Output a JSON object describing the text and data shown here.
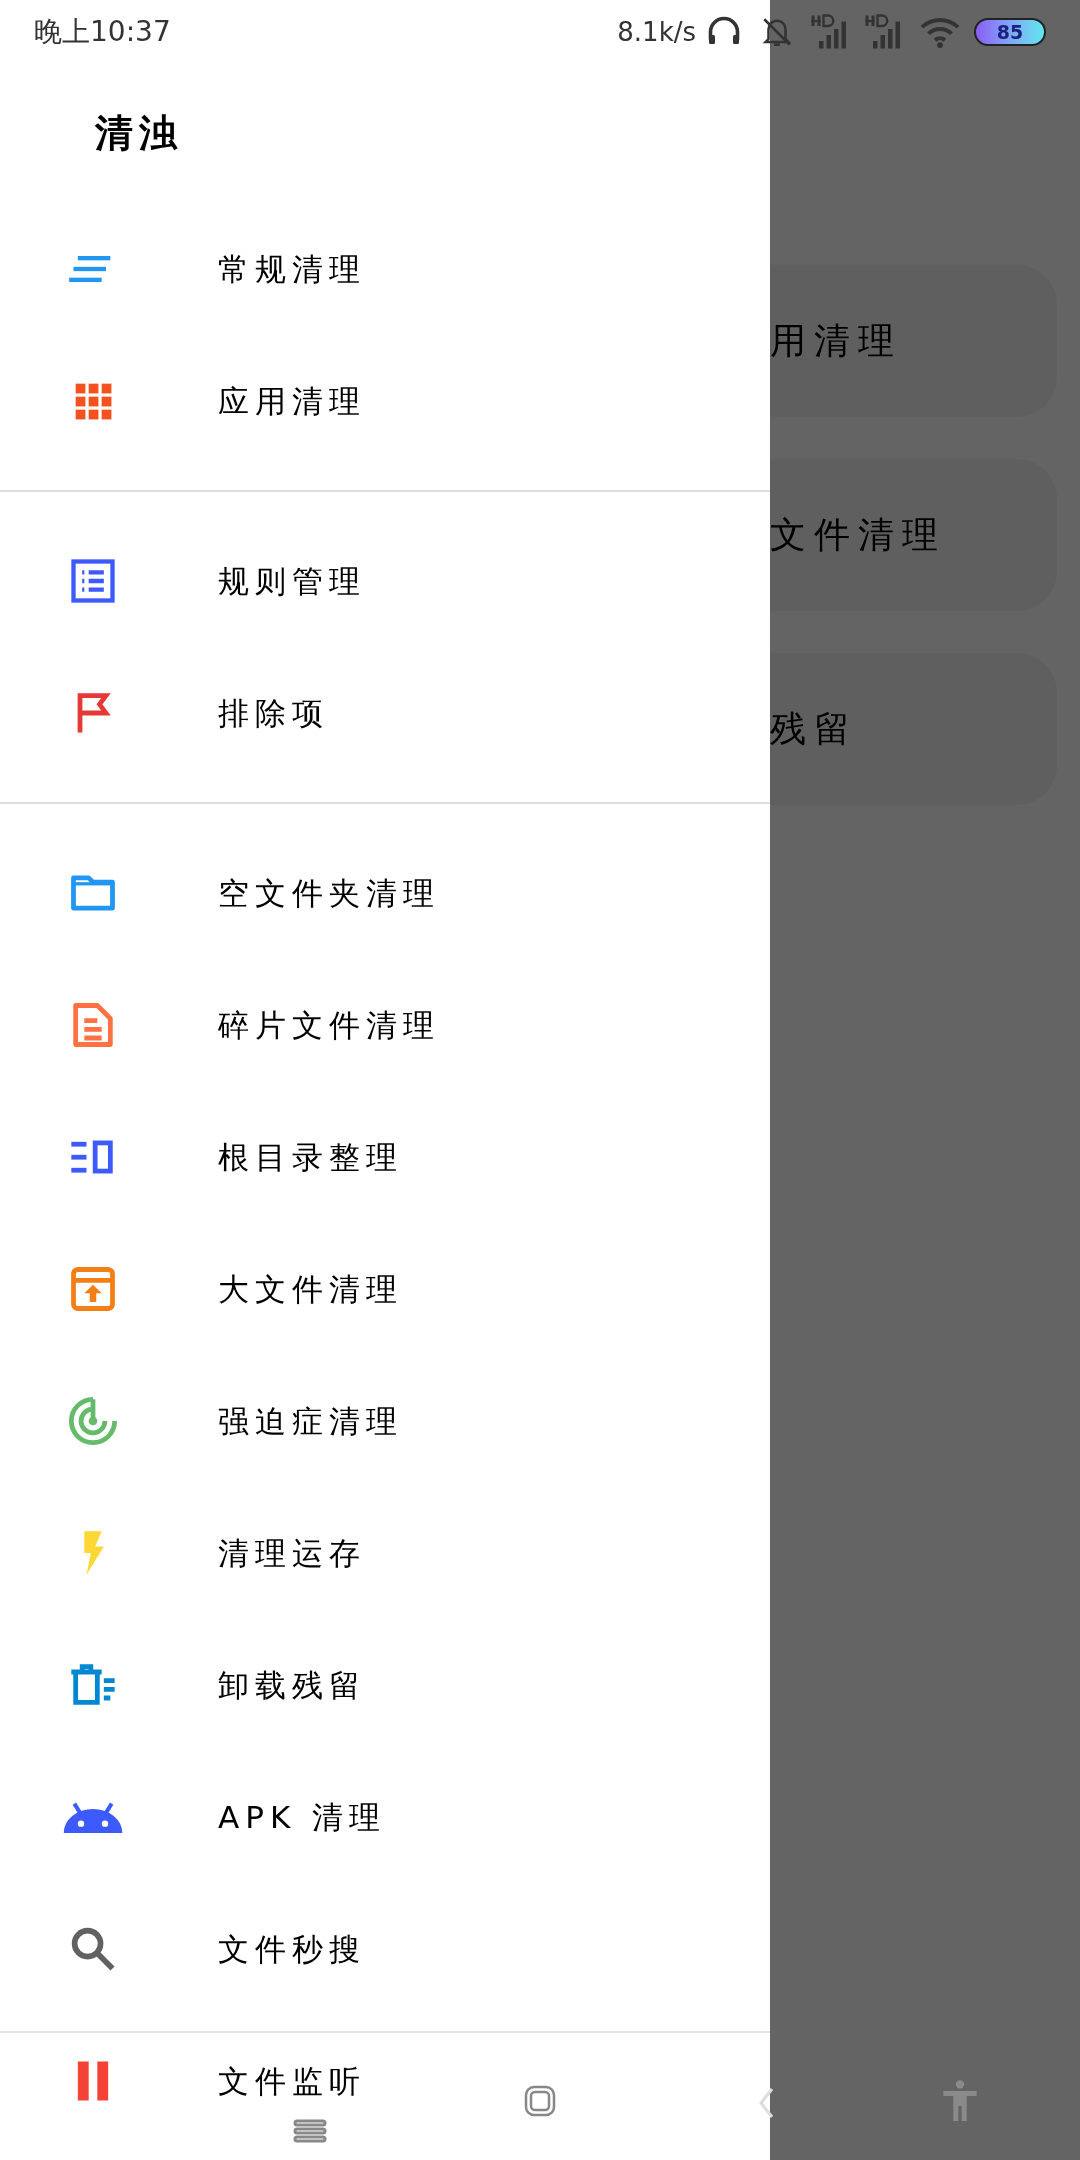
{
  "status_bar": {
    "time": "晚上10:37",
    "net_speed": "8.1k/s",
    "battery": "85"
  },
  "drawer": {
    "title": "清浊",
    "sections": [
      {
        "items": [
          {
            "label": "常规清理",
            "kind": "lines",
            "color": "#2196f3"
          },
          {
            "label": "应用清理",
            "kind": "grid",
            "color": "#f4511e"
          }
        ]
      },
      {
        "items": [
          {
            "label": "规则管理",
            "kind": "list",
            "color": "#3d5afe"
          },
          {
            "label": "排除项",
            "kind": "flag",
            "color": "#e53935"
          }
        ]
      },
      {
        "items": [
          {
            "label": "空文件夹清理",
            "kind": "folder",
            "color": "#2196f3"
          },
          {
            "label": "碎片文件清理",
            "kind": "document",
            "color": "#ff7043"
          },
          {
            "label": "根目录整理",
            "kind": "columns",
            "color": "#3d5afe"
          },
          {
            "label": "大文件清理",
            "kind": "archive",
            "color": "#f57f17"
          },
          {
            "label": "强迫症清理",
            "kind": "radar",
            "color": "#66bb6a"
          },
          {
            "label": "清理运存",
            "kind": "bolt",
            "color": "#fdd835"
          },
          {
            "label": "卸载残留",
            "kind": "trash",
            "color": "#0288d1"
          },
          {
            "label": "APK 清理",
            "kind": "android",
            "color": "#3d5afe"
          },
          {
            "label": "文件秒搜",
            "kind": "search",
            "color": "#616161"
          },
          {
            "label": "文件监听",
            "kind": "pause",
            "color": "#f44336"
          }
        ]
      }
    ]
  },
  "background_cards": [
    {
      "label": "用清理"
    },
    {
      "label": "文件清理"
    },
    {
      "label": "残留"
    }
  ]
}
